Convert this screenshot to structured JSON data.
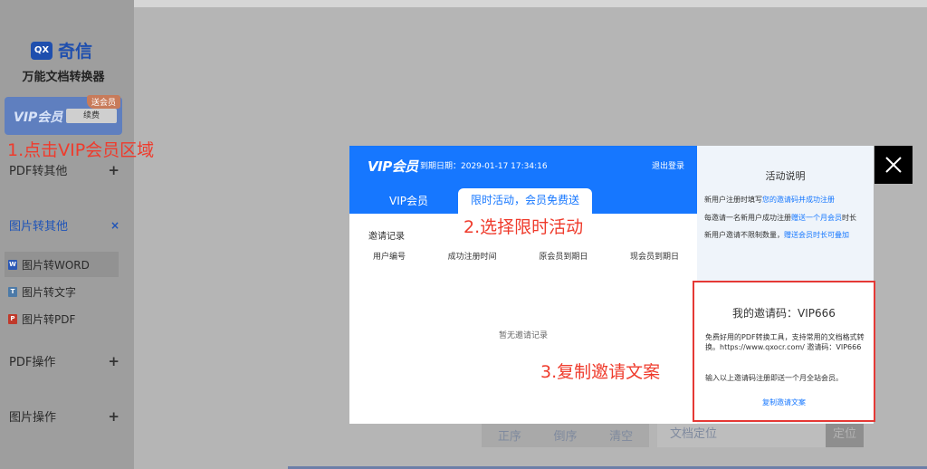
{
  "app": {
    "logo_badge": "QX",
    "logo_name": "奇信",
    "subtitle": "万能文档转换器",
    "brand_color": "#1677ff"
  },
  "vip_card": {
    "logo_text": "VIP会员",
    "renew_label": "续费",
    "gift_tag": "送会员"
  },
  "annotations": {
    "step1": "1.点击VIP会员区域",
    "step2": "2.选择限时活动",
    "step3": "3.复制邀请文案"
  },
  "sidebar": {
    "sections": [
      {
        "label": "PDF转其他",
        "toggle": "+"
      },
      {
        "label": "图片转其他",
        "toggle": "×"
      },
      {
        "label": "PDF操作",
        "toggle": "+"
      },
      {
        "label": "图片操作",
        "toggle": "+"
      }
    ],
    "sub_items": [
      {
        "label": "图片转WORD",
        "icon": "W",
        "icon_color": "#2b58b5"
      },
      {
        "label": "图片转文字",
        "icon": "T",
        "icon_color": "#4c7aa8"
      },
      {
        "label": "图片转PDF",
        "icon": "P",
        "icon_color": "#c0392b"
      }
    ]
  },
  "bottom_toolbar": {
    "buttons": [
      "正序",
      "倒序",
      "清空"
    ],
    "locate_placeholder": "文档定位",
    "locate_button": "定位"
  },
  "modal": {
    "logo_text": "VIP会员",
    "expiry": "到期日期：2029-01-17 17:34:16",
    "logout": "退出登录",
    "tab_vip": "VIP会员",
    "tab_limited": "限时活动，会员免费送",
    "records_title": "邀请记录",
    "columns": [
      "用户编号",
      "成功注册时间",
      "原会员到期日",
      "现会员到期日"
    ],
    "empty_text": "暂无邀请记录",
    "activity": {
      "title": "活动说明",
      "line1_a": "新用户注册时填写",
      "line1_b": "您的邀请码并成功注册",
      "line2_a": "每邀请一名新用户成功注册",
      "line2_b": "赠送一个月会员",
      "line2_c": "时长",
      "line3_a": "新用户邀请不限制数量，",
      "line3_b": "赠送会员时长可叠加"
    },
    "invite": {
      "title": "我的邀请码：VIP666",
      "text": "免费好用的PDF转换工具，支持常用的文档格式转换。https://www.qxocr.com/ 邀请码：VIP666",
      "note": "输入以上邀请码注册即送一个月全站会员。",
      "copy_label": "复制邀请文案"
    }
  }
}
